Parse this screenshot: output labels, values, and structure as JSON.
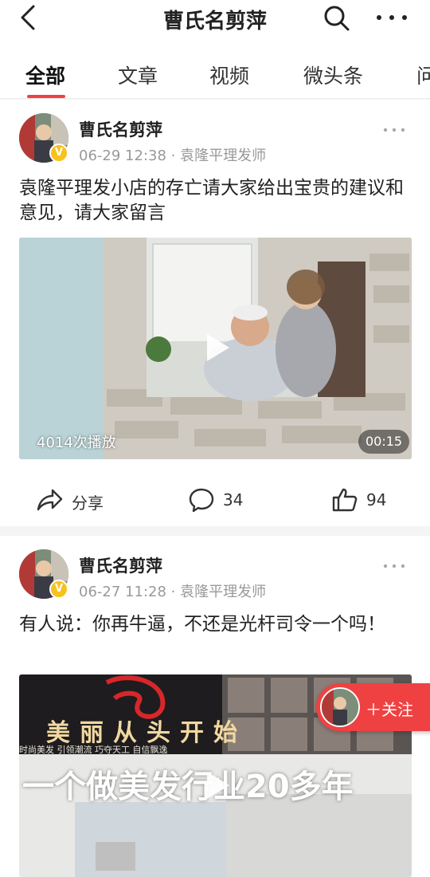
{
  "header": {
    "title": "曹氏名剪萍",
    "back_icon": "back-arrow-icon",
    "search_icon": "search-icon",
    "more_icon": "more-dots-icon"
  },
  "tabs": [
    {
      "label": "全部",
      "active": true
    },
    {
      "label": "文章",
      "active": false
    },
    {
      "label": "视频",
      "active": false
    },
    {
      "label": "微头条",
      "active": false
    },
    {
      "label": "问",
      "active": false
    }
  ],
  "accent_color": "#f04142",
  "posts": [
    {
      "author": "曹氏名剪萍",
      "verified_badge": "V",
      "date": "06-29 12:38",
      "source": "袁隆平理发师",
      "text": "袁隆平理发小店的存亡请大家给出宝贵的建议和意见，请大家留言",
      "video": {
        "play_count": "4014次播放",
        "duration": "00:15"
      },
      "actions": {
        "share_label": "分享",
        "comment_count": "34",
        "like_count": "94"
      }
    },
    {
      "author": "曹氏名剪萍",
      "verified_badge": "V",
      "date": "06-27 11:28",
      "source": "袁隆平理发师",
      "text": "有人说：你再牛逼，不还是光杆司令一个吗！",
      "video": {
        "sign_text": "美丽从头开始",
        "sign_sub": "时尚美发 引领潮流 巧夺天工 自信飘逸",
        "banner_text": "一个做美发行业20多年"
      }
    }
  ],
  "follow_button": {
    "label": "＋关注"
  },
  "separator": "·"
}
